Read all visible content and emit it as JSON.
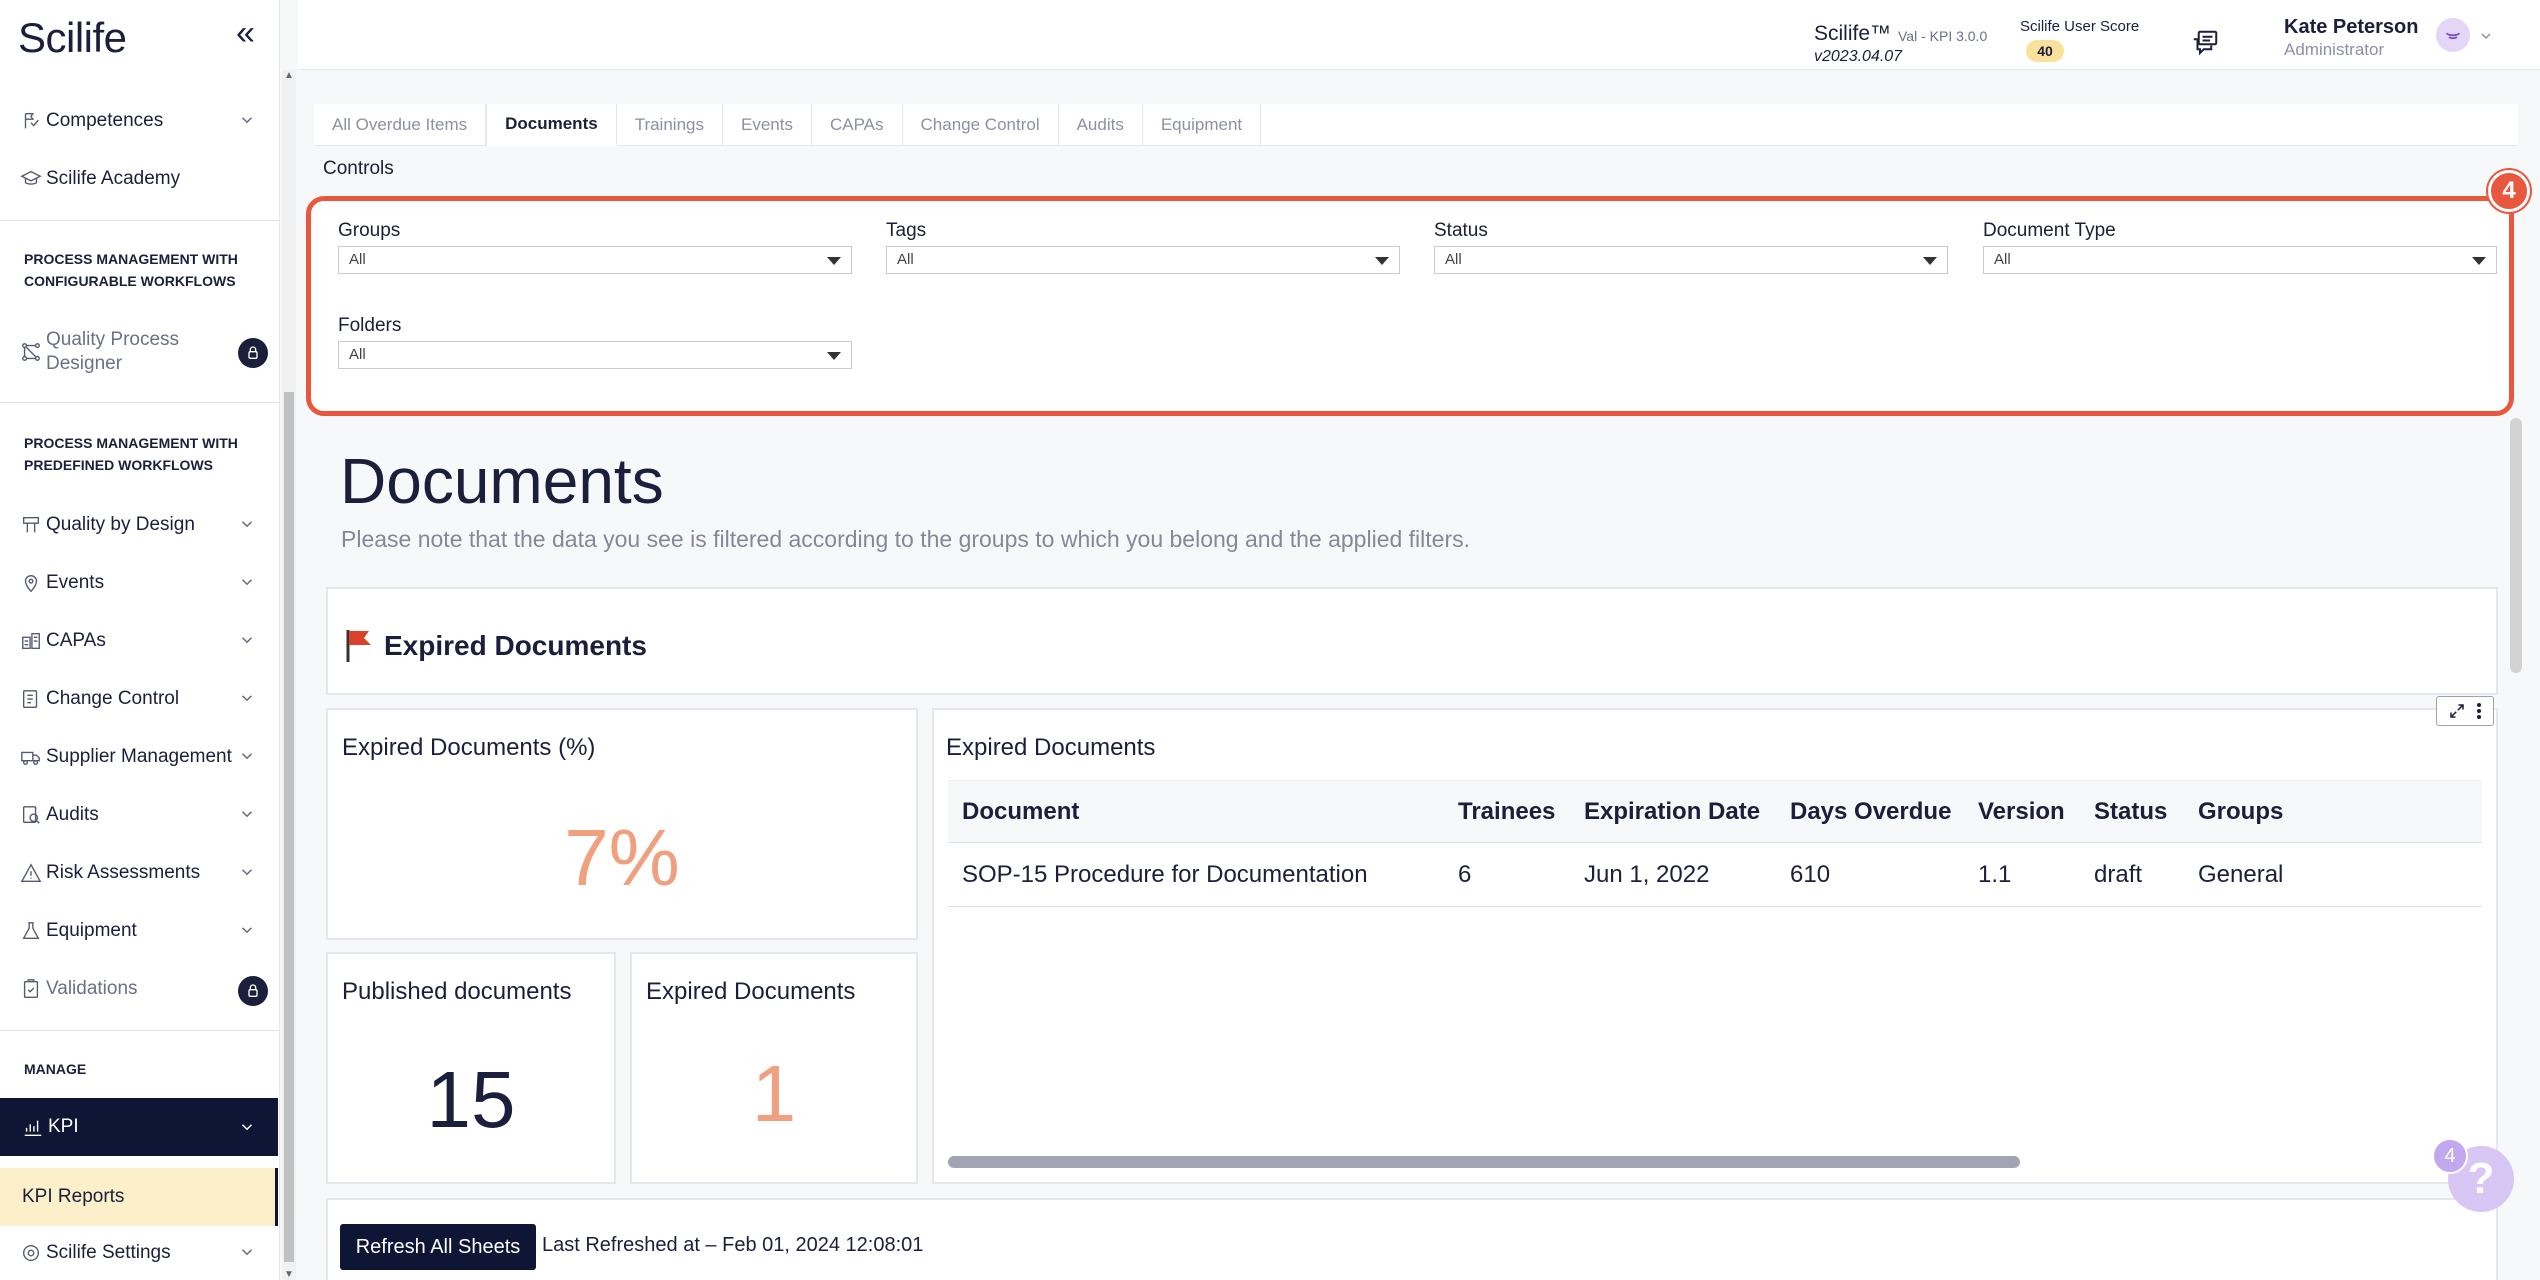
{
  "app": {
    "logo": "Scilife"
  },
  "sidebar": {
    "items_top": [
      {
        "label": "Competences",
        "icon": "competences-icon",
        "has_chevron": true
      },
      {
        "label": "Scilife Academy",
        "icon": "academy-icon",
        "has_chevron": false
      }
    ],
    "section1_title": "PROCESS MANAGEMENT WITH CONFIGURABLE WORKFLOWS",
    "qpd_label": "Quality Process Designer",
    "section2_title": "PROCESS MANAGEMENT WITH PREDEFINED WORKFLOWS",
    "items_mid": [
      {
        "label": "Quality by Design",
        "icon": "quality-by-design-icon"
      },
      {
        "label": "Events",
        "icon": "events-icon"
      },
      {
        "label": "CAPAs",
        "icon": "capas-icon"
      },
      {
        "label": "Change Control",
        "icon": "change-control-icon"
      },
      {
        "label": "Supplier Management",
        "icon": "supplier-icon"
      },
      {
        "label": "Audits",
        "icon": "audits-icon"
      },
      {
        "label": "Risk Assessments",
        "icon": "risk-icon"
      },
      {
        "label": "Equipment",
        "icon": "equipment-icon"
      }
    ],
    "validations_label": "Validations",
    "manage_title": "MANAGE",
    "kpi_label": "KPI",
    "kpi_reports_label": "KPI Reports",
    "settings_label": "Scilife Settings"
  },
  "header": {
    "product": "Scilife™",
    "product_sub": "Val - KPI 3.0.0",
    "version": "v2023.04.07",
    "score_label": "Scilife User Score",
    "score_value": "40",
    "user_name": "Kate Peterson",
    "user_role": "Administrator"
  },
  "tabs": [
    "All Overdue Items",
    "Documents",
    "Trainings",
    "Events",
    "CAPAs",
    "Change Control",
    "Audits",
    "Equipment"
  ],
  "active_tab": "Documents",
  "controls": {
    "label": "Controls",
    "step_badge": "4",
    "filters": [
      {
        "label": "Groups",
        "value": "All"
      },
      {
        "label": "Tags",
        "value": "All"
      },
      {
        "label": "Status",
        "value": "All"
      },
      {
        "label": "Document Type",
        "value": "All"
      },
      {
        "label": "Folders",
        "value": "All"
      }
    ]
  },
  "page": {
    "title": "Documents",
    "note": "Please note that the data you see is filtered according to the groups to which you belong and the applied filters."
  },
  "section": {
    "title": "Expired Documents"
  },
  "kpis": {
    "expired_pct": {
      "label": "Expired Documents (%)",
      "value": "7%",
      "color": "#f0a07e"
    },
    "published": {
      "label": "Published documents",
      "value": "15",
      "color": "#1b1f3b"
    },
    "expired": {
      "label": "Expired Documents",
      "value": "1",
      "color": "#f0a07e"
    }
  },
  "table": {
    "title": "Expired Documents",
    "columns": [
      "Document",
      "Trainees",
      "Expiration Date",
      "Days Overdue",
      "Version",
      "Status",
      "Groups"
    ],
    "rows": [
      [
        "SOP-15 Procedure for Documentation",
        "6",
        "Jun 1, 2022",
        "610",
        "1.1",
        "draft",
        "General"
      ]
    ]
  },
  "footer": {
    "refresh_label": "Refresh All Sheets",
    "last_refreshed": "Last Refreshed at – Feb 01, 2024 12:08:01"
  },
  "help": {
    "count": "4",
    "label": "?"
  }
}
